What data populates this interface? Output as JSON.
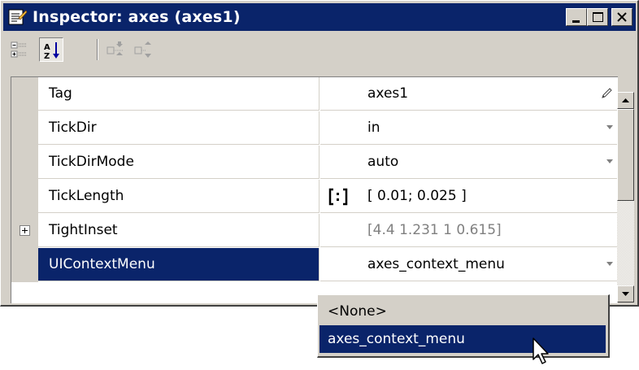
{
  "window": {
    "title": "Inspector:  axes (axes1)",
    "controls": [
      "minimize",
      "maximize",
      "close"
    ],
    "colors": {
      "titlebar": "#0a246a",
      "chrome": "#d4d0c8",
      "selection": "#0a246a"
    }
  },
  "toolbar": {
    "buttons": [
      {
        "icon": "categorized-view-icon",
        "pressed": false
      },
      {
        "icon": "alphabetical-sort-icon",
        "pressed": true
      },
      {
        "icon": "expand-all-icon",
        "pressed": false
      },
      {
        "icon": "collapse-all-icon",
        "pressed": false
      }
    ]
  },
  "properties": [
    {
      "name": "Tag",
      "value": "axes1",
      "control": "pencil-icon"
    },
    {
      "name": "TickDir",
      "value": "in",
      "control": "dropdown-arrow-icon"
    },
    {
      "name": "TickDirMode",
      "value": "auto",
      "control": "dropdown-arrow-icon"
    },
    {
      "name": "TickLength",
      "value": "[ 0.01; 0.025 ]",
      "control": "array-editor-icon"
    },
    {
      "name": "TightInset",
      "value": "[4.4 1.231 1 0.615]",
      "control": "expand-icon",
      "readonly": true
    },
    {
      "name": "UIContextMenu",
      "value": "axes_context_menu",
      "control": "dropdown-arrow-icon",
      "selected": true
    }
  ],
  "dropdown": {
    "options": [
      "<None>",
      "axes_context_menu"
    ],
    "highlighted": "axes_context_menu"
  }
}
